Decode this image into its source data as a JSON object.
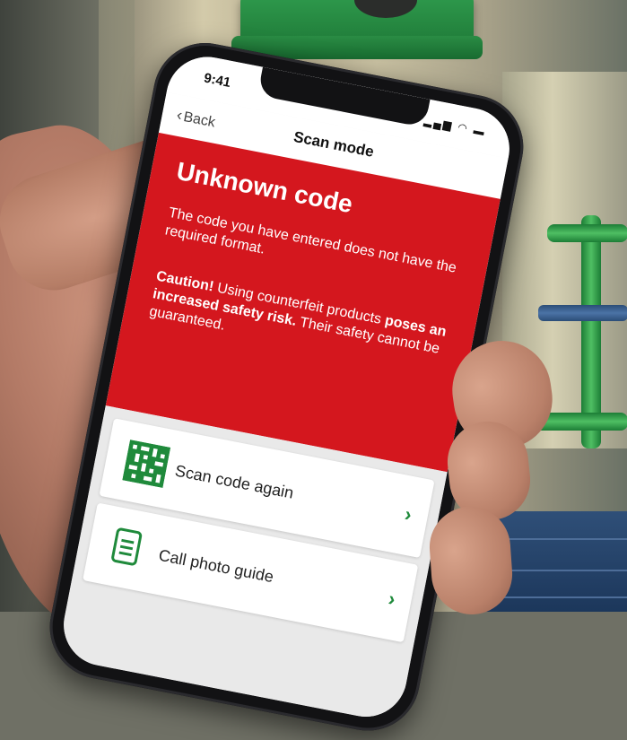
{
  "status_bar": {
    "time": "9:41",
    "signal_icon": "signal-icon",
    "wifi_icon": "wifi-icon",
    "battery_icon": "battery-icon"
  },
  "nav": {
    "back_label": "Back",
    "title": "Scan mode"
  },
  "alert": {
    "title": "Unknown code",
    "message": "The code you have entered does not have the required format.",
    "caution_lead": "Caution!",
    "caution_mid": " Using counterfeit products ",
    "caution_bold": "poses an increased safety risk.",
    "caution_tail": " Their safety cannot be guaranteed.",
    "background_color": "#d4171e"
  },
  "actions": [
    {
      "label": "Scan code again",
      "icon": "qr-code-icon",
      "arrow": "›"
    },
    {
      "label": "Call photo guide",
      "icon": "document-icon",
      "arrow": "›"
    }
  ],
  "accent_color": "#1f8a3b"
}
